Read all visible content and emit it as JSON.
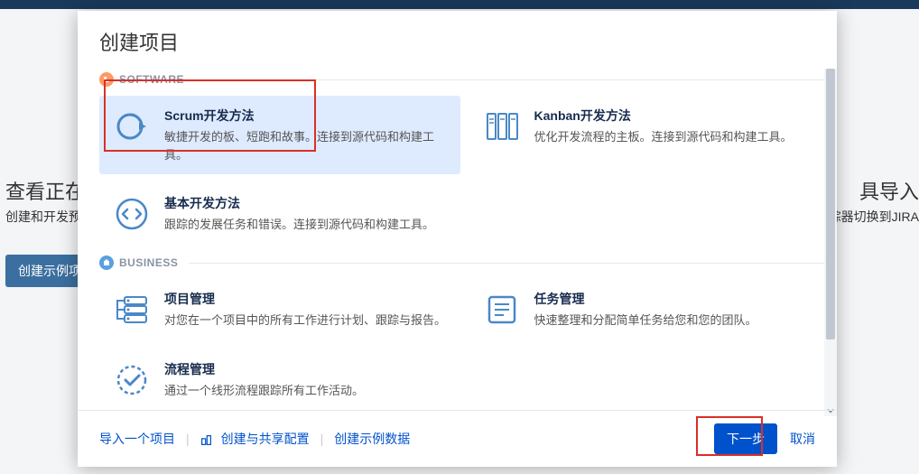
{
  "background": {
    "left_title": "查看正在",
    "left_sub": "创建和开发预",
    "left_button": "创建示例项",
    "right_title": "具导入",
    "right_sub": "踪器切换到JIRA"
  },
  "modal": {
    "title": "创建项目",
    "sections": {
      "software": {
        "label": "SOFTWARE",
        "options": [
          {
            "title": "Scrum开发方法",
            "desc": "敏捷开发的板、短跑和故事。连接到源代码和构建工具。"
          },
          {
            "title": "Kanban开发方法",
            "desc": "优化开发流程的主板。连接到源代码和构建工具。"
          },
          {
            "title": "基本开发方法",
            "desc": "跟踪的发展任务和错误。连接到源代码和构建工具。"
          }
        ]
      },
      "business": {
        "label": "BUSINESS",
        "options": [
          {
            "title": "项目管理",
            "desc": "对您在一个项目中的所有工作进行计划、跟踪与报告。"
          },
          {
            "title": "任务管理",
            "desc": "快速整理和分配简单任务给您和您的团队。"
          },
          {
            "title": "流程管理",
            "desc": "通过一个线形流程跟踪所有工作活动。"
          }
        ]
      }
    },
    "footer": {
      "import_link": "导入一个项目",
      "share_config": "创建与共享配置",
      "sample_data": "创建示例数据",
      "next": "下一步",
      "cancel": "取消"
    }
  },
  "colors": {
    "primary": "#0052cc",
    "selected_bg": "#deebff",
    "highlight": "#d93025"
  }
}
